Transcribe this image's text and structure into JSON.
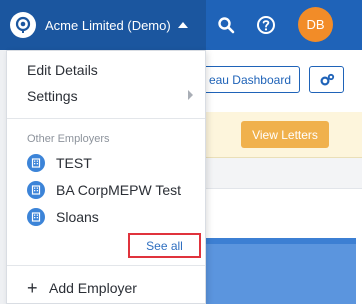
{
  "header": {
    "company_name": "Acme Limited (Demo)",
    "user_initials": "DB",
    "icons": [
      "pin-logo-icon",
      "search-icon",
      "help-icon"
    ]
  },
  "page": {
    "dashboard_button_label": "eau Dashboard",
    "view_letters_label": "View Letters"
  },
  "dropdown": {
    "edit_details": "Edit Details",
    "settings": "Settings",
    "other_employers_heading": "Other Employers",
    "employers": [
      {
        "name": "TEST"
      },
      {
        "name": "BA CorpMEPW Test"
      },
      {
        "name": "Sloans"
      }
    ],
    "see_all": "See all",
    "add_employer": "Add Employer",
    "add_icon": "+"
  },
  "colors": {
    "header_blue": "#1f63b8",
    "brand_blue": "#1b569f",
    "avatar_orange": "#f28c28",
    "letters_orange": "#f0b14d",
    "highlight_red": "#e0333c",
    "link_blue": "#2f6fc0"
  }
}
